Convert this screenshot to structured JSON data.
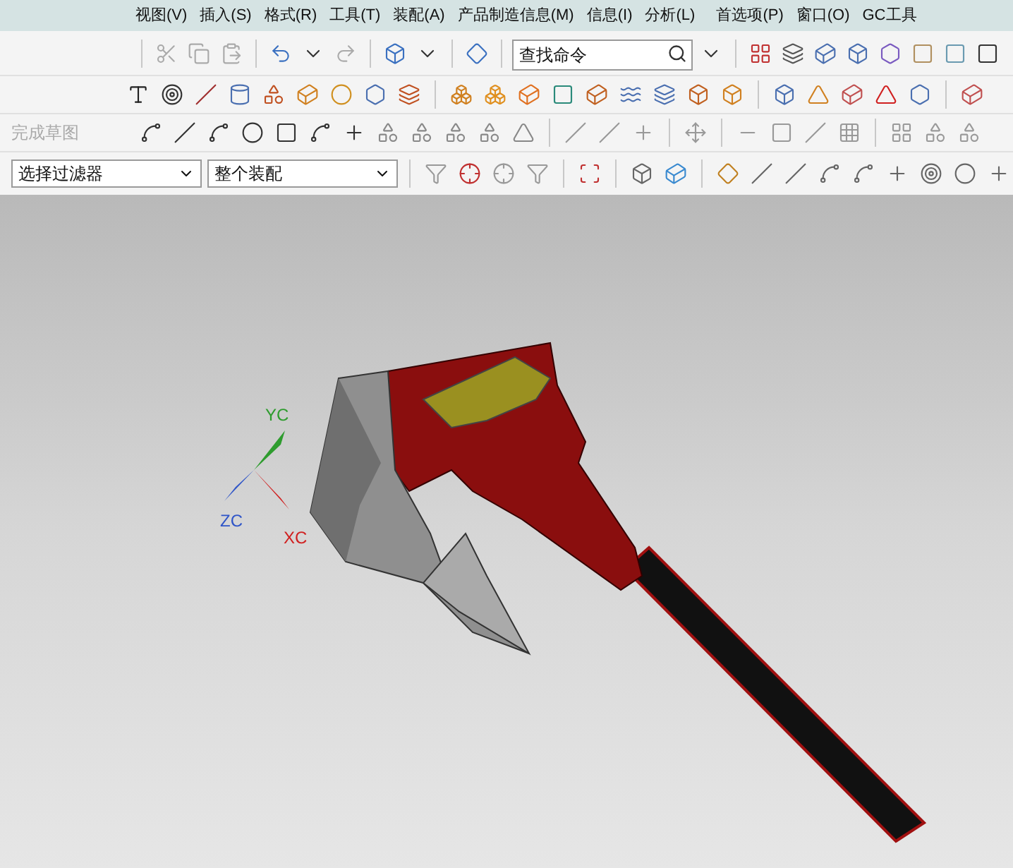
{
  "menu_bar": {
    "items": [
      "视图(V)",
      "插入(S)",
      "格式(R)",
      "工具(T)",
      "装配(A)",
      "产品制造信息(M)",
      "信息(I)",
      "分析(L)",
      "首选项(P)",
      "窗口(O)",
      "GC工具"
    ]
  },
  "command_search": {
    "placeholder": "查找命令"
  },
  "sketch_toolbar": {
    "finish_label": "完成草图"
  },
  "selection_bar": {
    "type_filter": "选择过滤器",
    "scope": "整个装配"
  },
  "viewport": {
    "axis_labels": [
      {
        "text": "YC",
        "color": "#2e9c2e"
      },
      {
        "text": "ZC",
        "color": "#2f55c8"
      },
      {
        "text": "XC",
        "color": "#d02020"
      }
    ]
  }
}
